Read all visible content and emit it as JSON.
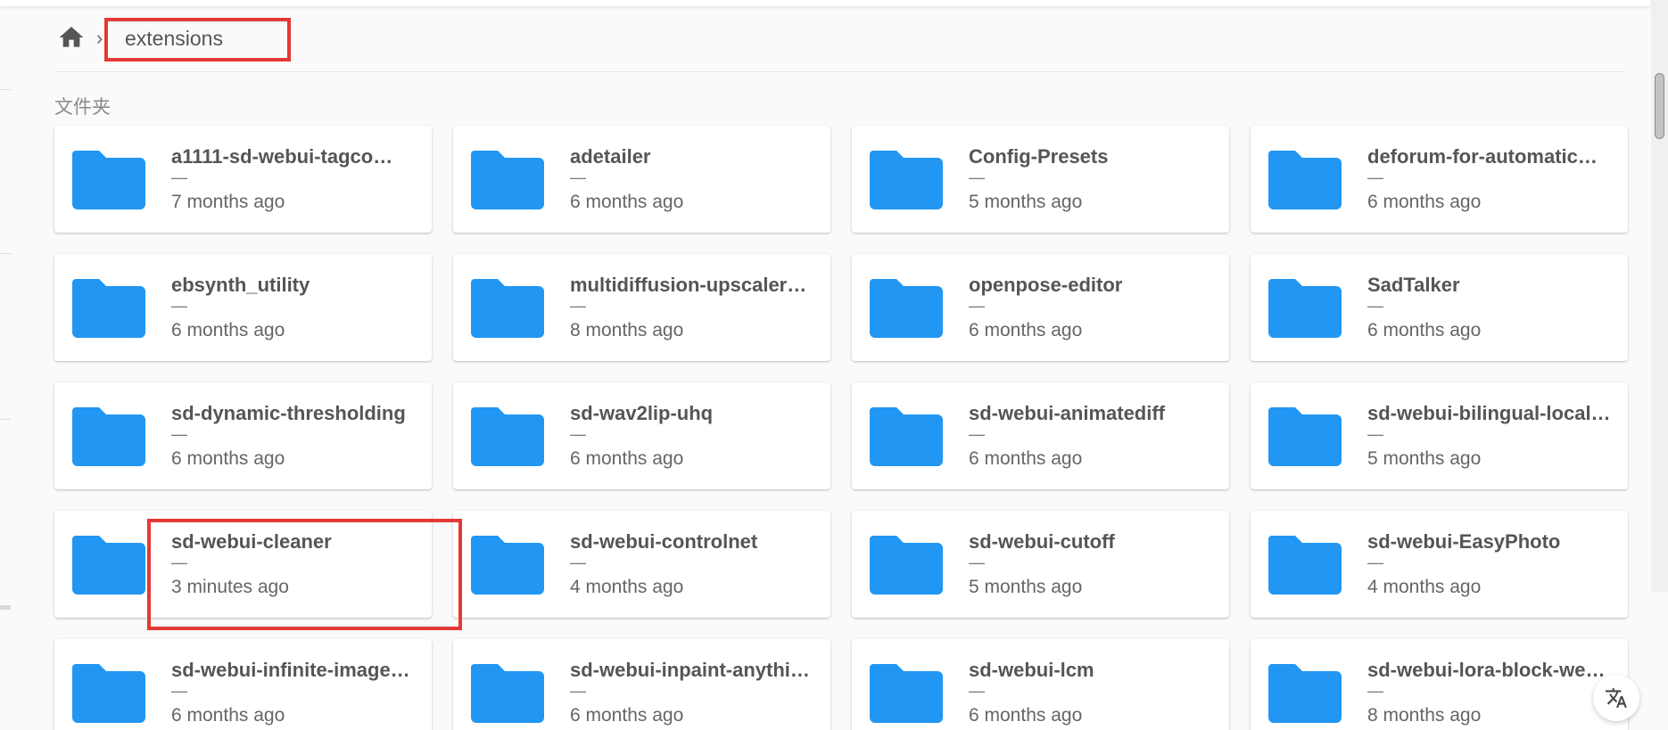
{
  "breadcrumb": {
    "separator": "›",
    "current_folder": "extensions"
  },
  "section": {
    "label": "文件夹"
  },
  "colors": {
    "folder_icon": "#2196f3",
    "highlight": "#e53935",
    "text": "#555555"
  },
  "folders": [
    {
      "name": "a1111-sd-webui-tagco…",
      "size": "—",
      "modified": "7 months ago"
    },
    {
      "name": "adetailer",
      "size": "—",
      "modified": "6 months ago"
    },
    {
      "name": "Config-Presets",
      "size": "—",
      "modified": "5 months ago"
    },
    {
      "name": "deforum-for-automatic…",
      "size": "—",
      "modified": "6 months ago"
    },
    {
      "name": "ebsynth_utility",
      "size": "—",
      "modified": "6 months ago"
    },
    {
      "name": "multidiffusion-upscaler…",
      "size": "—",
      "modified": "8 months ago"
    },
    {
      "name": "openpose-editor",
      "size": "—",
      "modified": "6 months ago"
    },
    {
      "name": "SadTalker",
      "size": "—",
      "modified": "6 months ago"
    },
    {
      "name": "sd-dynamic-thresholding",
      "size": "—",
      "modified": "6 months ago"
    },
    {
      "name": "sd-wav2lip-uhq",
      "size": "—",
      "modified": "6 months ago"
    },
    {
      "name": "sd-webui-animatediff",
      "size": "—",
      "modified": "6 months ago"
    },
    {
      "name": "sd-webui-bilingual-local…",
      "size": "—",
      "modified": "5 months ago"
    },
    {
      "name": "sd-webui-cleaner",
      "size": "—",
      "modified": "3 minutes ago"
    },
    {
      "name": "sd-webui-controlnet",
      "size": "—",
      "modified": "4 months ago"
    },
    {
      "name": "sd-webui-cutoff",
      "size": "—",
      "modified": "5 months ago"
    },
    {
      "name": "sd-webui-EasyPhoto",
      "size": "—",
      "modified": "4 months ago"
    },
    {
      "name": "sd-webui-infinite-image…",
      "size": "—",
      "modified": "6 months ago"
    },
    {
      "name": "sd-webui-inpaint-anythi…",
      "size": "—",
      "modified": "6 months ago"
    },
    {
      "name": "sd-webui-lcm",
      "size": "—",
      "modified": "6 months ago"
    },
    {
      "name": "sd-webui-lora-block-we…",
      "size": "—",
      "modified": "8 months ago"
    }
  ],
  "icons": {
    "home": "home-icon",
    "folder": "folder-icon",
    "translate": "translate-icon"
  }
}
